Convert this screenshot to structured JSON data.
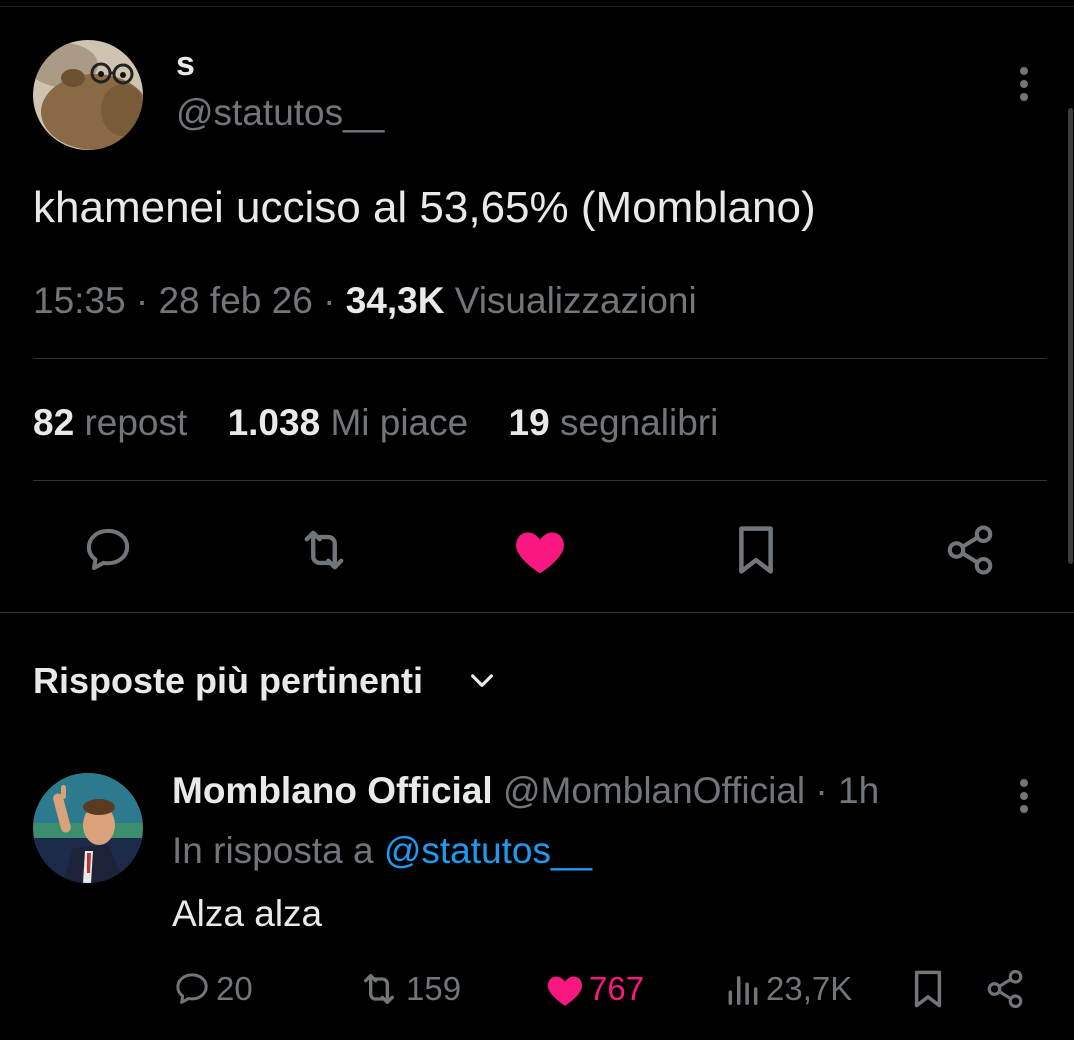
{
  "tweet": {
    "author_name": "s",
    "author_handle": "@statutos__",
    "text": "khamenei ucciso al 53,65% (Momblano)",
    "time": "15:35",
    "date": "28 feb 26",
    "views_count": "34,3K",
    "views_label": "Visualizzazioni",
    "sep": "·",
    "stats": {
      "reposts": "82",
      "reposts_label": "repost",
      "likes": "1.038",
      "likes_label": "Mi piace",
      "bookmarks": "19",
      "bookmarks_label": "segnalibri"
    }
  },
  "replies_section": {
    "sort_label": "Risposte più pertinenti"
  },
  "reply": {
    "author_name": "Momblano Official",
    "author_handle": "@MomblanOfficial",
    "age": "· 1h",
    "in_reply_prefix": "In risposta a",
    "in_reply_handle": "@statutos__",
    "text": "Alza alza",
    "counts": {
      "replies": "20",
      "reposts": "159",
      "likes": "767",
      "views": "23,7K"
    }
  },
  "colors": {
    "background": "#000000",
    "text_primary": "#e7e9ea",
    "text_secondary": "#71767b",
    "accent_link": "#1d9bf0",
    "like_active": "#f91880",
    "divider": "#2f3336"
  },
  "icons": {
    "reply": "speech-bubble-icon",
    "repost": "repost-arrows-icon",
    "like": "heart-filled-icon",
    "bookmark": "bookmark-icon",
    "share": "share-nodes-icon",
    "views": "bar-chart-icon",
    "more": "vertical-dots-icon",
    "sort": "chevron-down-icon"
  }
}
